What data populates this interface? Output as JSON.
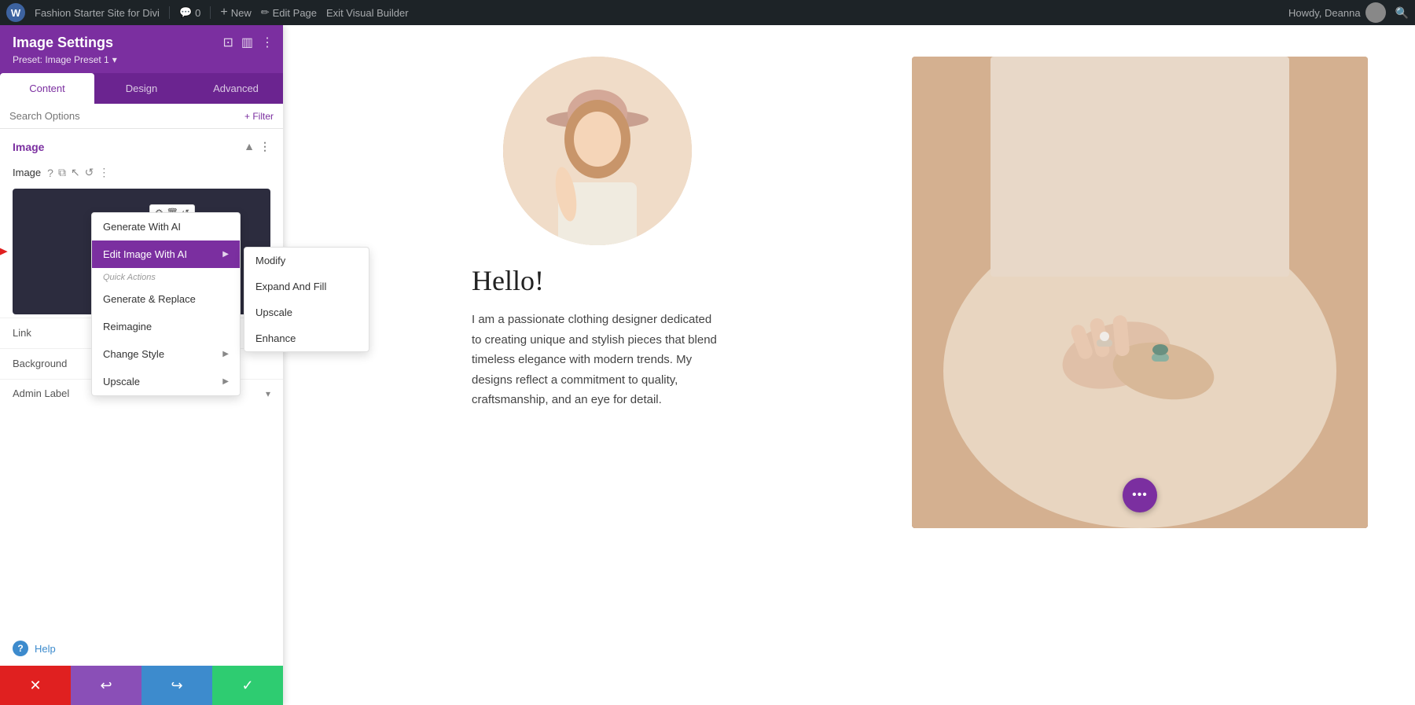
{
  "topbar": {
    "wp_icon": "W",
    "site_name": "Fashion Starter Site for Divi",
    "comments_count": "0",
    "new_label": "New",
    "edit_page_label": "Edit Page",
    "exit_builder_label": "Exit Visual Builder",
    "howdy_label": "Howdy, Deanna",
    "search_icon": "🔍"
  },
  "sidebar": {
    "title": "Image Settings",
    "preset_label": "Preset: Image Preset 1",
    "preset_chevron": "▾",
    "tabs": [
      {
        "id": "content",
        "label": "Content",
        "active": true
      },
      {
        "id": "design",
        "label": "Design",
        "active": false
      },
      {
        "id": "advanced",
        "label": "Advanced",
        "active": false
      }
    ],
    "search_placeholder": "Search Options",
    "filter_label": "+ Filter",
    "section_image": {
      "title": "Image",
      "field_label": "Image"
    },
    "dropdown_primary": {
      "items": [
        {
          "id": "generate",
          "label": "Generate With AI",
          "active": false,
          "has_submenu": false
        },
        {
          "id": "edit_image_with_ai",
          "label": "Edit Image With AI",
          "active": true,
          "has_submenu": true
        },
        {
          "id": "quick_actions_header",
          "label": "Quick Actions",
          "is_header": true
        },
        {
          "id": "generate_replace",
          "label": "Generate & Replace",
          "active": false,
          "has_submenu": false
        },
        {
          "id": "reimagine",
          "label": "Reimagine",
          "active": false,
          "has_submenu": false
        },
        {
          "id": "change_style",
          "label": "Change Style",
          "active": false,
          "has_submenu": true
        },
        {
          "id": "upscale",
          "label": "Upscale",
          "active": false,
          "has_submenu": true
        }
      ]
    },
    "dropdown_secondary": {
      "items": [
        {
          "id": "modify",
          "label": "Modify"
        },
        {
          "id": "expand_and_fill",
          "label": "Expand And Fill"
        },
        {
          "id": "upscale",
          "label": "Upscale"
        },
        {
          "id": "enhance",
          "label": "Enhance"
        }
      ]
    },
    "link_section": "Link",
    "background_section": "Background",
    "admin_label": "Admin Label",
    "help_label": "Help",
    "bottom_buttons": {
      "cancel": "✕",
      "undo": "↩",
      "redo": "↪",
      "save": "✓"
    }
  },
  "page": {
    "hello_heading": "Hello!",
    "description": "I am a passionate clothing designer dedicated to creating unique and stylish pieces that blend timeless elegance with modern trends. My designs reflect a commitment to quality, craftsmanship, and an eye for detail.",
    "floating_dots": "•••"
  }
}
